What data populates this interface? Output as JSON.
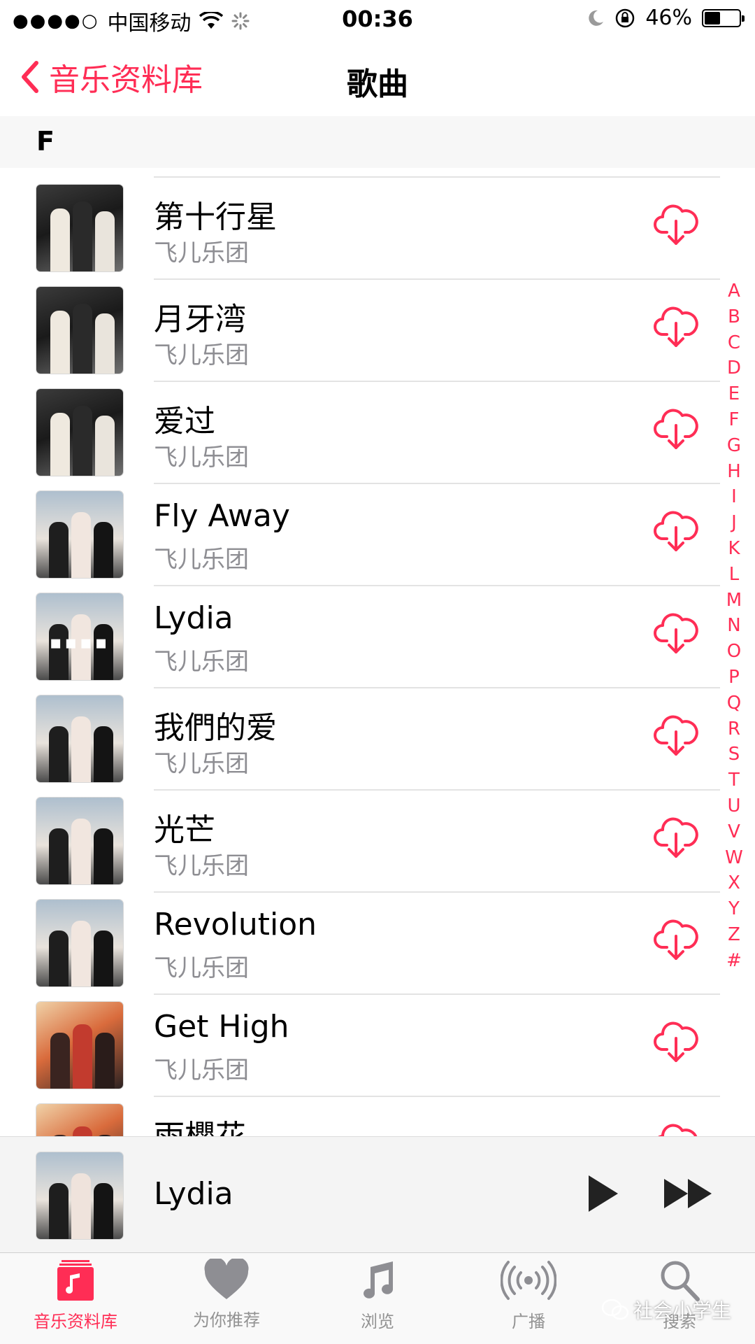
{
  "status_bar": {
    "signal_dots": "●●●●○",
    "carrier": "中国移动",
    "time": "00:36",
    "battery_percent": "46%",
    "battery_level": 0.46
  },
  "nav": {
    "back_label": "音乐资料库",
    "title": "歌曲"
  },
  "section": {
    "header": "F"
  },
  "songs": [
    {
      "title": "第十行星",
      "artist": "飞儿乐团",
      "art": "dark"
    },
    {
      "title": "月牙湾",
      "artist": "飞儿乐团",
      "art": "dark"
    },
    {
      "title": "爱过",
      "artist": "飞儿乐团",
      "art": "dark"
    },
    {
      "title": "Fly Away",
      "artist": "飞儿乐团",
      "art": "sky"
    },
    {
      "title": "Lydia",
      "artist": "飞儿乐团",
      "art": "sky"
    },
    {
      "title": "我們的爱",
      "artist": "飞儿乐团",
      "art": "sky"
    },
    {
      "title": "光芒",
      "artist": "飞儿乐团",
      "art": "sky"
    },
    {
      "title": "Revolution",
      "artist": "飞儿乐团",
      "art": "sky"
    },
    {
      "title": "Get High",
      "artist": "飞儿乐团",
      "art": "warm"
    },
    {
      "title": "雨櫻花",
      "artist": "",
      "art": "warm"
    }
  ],
  "index_letters": [
    "A",
    "B",
    "C",
    "D",
    "E",
    "F",
    "G",
    "H",
    "I",
    "J",
    "K",
    "L",
    "M",
    "N",
    "O",
    "P",
    "Q",
    "R",
    "S",
    "T",
    "U",
    "V",
    "W",
    "X",
    "Y",
    "Z",
    "#"
  ],
  "now_playing": {
    "title": "Lydia"
  },
  "tabs": [
    {
      "label": "音乐资料库",
      "icon": "library-icon",
      "active": true
    },
    {
      "label": "为你推荐",
      "icon": "heart-icon",
      "active": false
    },
    {
      "label": "浏览",
      "icon": "music-note-icon",
      "active": false
    },
    {
      "label": "广播",
      "icon": "radio-icon",
      "active": false
    },
    {
      "label": "搜索",
      "icon": "search-icon",
      "active": false
    }
  ],
  "watermark": "社会小学生",
  "colors": {
    "accent": "#ff2d55",
    "secondary_text": "#8e8e93"
  }
}
